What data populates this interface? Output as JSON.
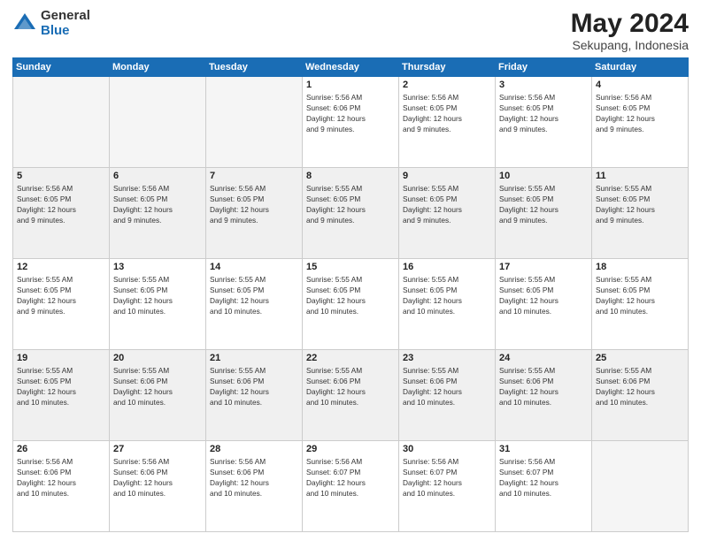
{
  "header": {
    "logo_general": "General",
    "logo_blue": "Blue",
    "month_title": "May 2024",
    "subtitle": "Sekupang, Indonesia"
  },
  "weekdays": [
    "Sunday",
    "Monday",
    "Tuesday",
    "Wednesday",
    "Thursday",
    "Friday",
    "Saturday"
  ],
  "weeks": [
    [
      {
        "day": "",
        "info": ""
      },
      {
        "day": "",
        "info": ""
      },
      {
        "day": "",
        "info": ""
      },
      {
        "day": "1",
        "info": "Sunrise: 5:56 AM\nSunset: 6:06 PM\nDaylight: 12 hours\nand 9 minutes."
      },
      {
        "day": "2",
        "info": "Sunrise: 5:56 AM\nSunset: 6:05 PM\nDaylight: 12 hours\nand 9 minutes."
      },
      {
        "day": "3",
        "info": "Sunrise: 5:56 AM\nSunset: 6:05 PM\nDaylight: 12 hours\nand 9 minutes."
      },
      {
        "day": "4",
        "info": "Sunrise: 5:56 AM\nSunset: 6:05 PM\nDaylight: 12 hours\nand 9 minutes."
      }
    ],
    [
      {
        "day": "5",
        "info": "Sunrise: 5:56 AM\nSunset: 6:05 PM\nDaylight: 12 hours\nand 9 minutes."
      },
      {
        "day": "6",
        "info": "Sunrise: 5:56 AM\nSunset: 6:05 PM\nDaylight: 12 hours\nand 9 minutes."
      },
      {
        "day": "7",
        "info": "Sunrise: 5:56 AM\nSunset: 6:05 PM\nDaylight: 12 hours\nand 9 minutes."
      },
      {
        "day": "8",
        "info": "Sunrise: 5:55 AM\nSunset: 6:05 PM\nDaylight: 12 hours\nand 9 minutes."
      },
      {
        "day": "9",
        "info": "Sunrise: 5:55 AM\nSunset: 6:05 PM\nDaylight: 12 hours\nand 9 minutes."
      },
      {
        "day": "10",
        "info": "Sunrise: 5:55 AM\nSunset: 6:05 PM\nDaylight: 12 hours\nand 9 minutes."
      },
      {
        "day": "11",
        "info": "Sunrise: 5:55 AM\nSunset: 6:05 PM\nDaylight: 12 hours\nand 9 minutes."
      }
    ],
    [
      {
        "day": "12",
        "info": "Sunrise: 5:55 AM\nSunset: 6:05 PM\nDaylight: 12 hours\nand 9 minutes."
      },
      {
        "day": "13",
        "info": "Sunrise: 5:55 AM\nSunset: 6:05 PM\nDaylight: 12 hours\nand 10 minutes."
      },
      {
        "day": "14",
        "info": "Sunrise: 5:55 AM\nSunset: 6:05 PM\nDaylight: 12 hours\nand 10 minutes."
      },
      {
        "day": "15",
        "info": "Sunrise: 5:55 AM\nSunset: 6:05 PM\nDaylight: 12 hours\nand 10 minutes."
      },
      {
        "day": "16",
        "info": "Sunrise: 5:55 AM\nSunset: 6:05 PM\nDaylight: 12 hours\nand 10 minutes."
      },
      {
        "day": "17",
        "info": "Sunrise: 5:55 AM\nSunset: 6:05 PM\nDaylight: 12 hours\nand 10 minutes."
      },
      {
        "day": "18",
        "info": "Sunrise: 5:55 AM\nSunset: 6:05 PM\nDaylight: 12 hours\nand 10 minutes."
      }
    ],
    [
      {
        "day": "19",
        "info": "Sunrise: 5:55 AM\nSunset: 6:05 PM\nDaylight: 12 hours\nand 10 minutes."
      },
      {
        "day": "20",
        "info": "Sunrise: 5:55 AM\nSunset: 6:06 PM\nDaylight: 12 hours\nand 10 minutes."
      },
      {
        "day": "21",
        "info": "Sunrise: 5:55 AM\nSunset: 6:06 PM\nDaylight: 12 hours\nand 10 minutes."
      },
      {
        "day": "22",
        "info": "Sunrise: 5:55 AM\nSunset: 6:06 PM\nDaylight: 12 hours\nand 10 minutes."
      },
      {
        "day": "23",
        "info": "Sunrise: 5:55 AM\nSunset: 6:06 PM\nDaylight: 12 hours\nand 10 minutes."
      },
      {
        "day": "24",
        "info": "Sunrise: 5:55 AM\nSunset: 6:06 PM\nDaylight: 12 hours\nand 10 minutes."
      },
      {
        "day": "25",
        "info": "Sunrise: 5:55 AM\nSunset: 6:06 PM\nDaylight: 12 hours\nand 10 minutes."
      }
    ],
    [
      {
        "day": "26",
        "info": "Sunrise: 5:56 AM\nSunset: 6:06 PM\nDaylight: 12 hours\nand 10 minutes."
      },
      {
        "day": "27",
        "info": "Sunrise: 5:56 AM\nSunset: 6:06 PM\nDaylight: 12 hours\nand 10 minutes."
      },
      {
        "day": "28",
        "info": "Sunrise: 5:56 AM\nSunset: 6:06 PM\nDaylight: 12 hours\nand 10 minutes."
      },
      {
        "day": "29",
        "info": "Sunrise: 5:56 AM\nSunset: 6:07 PM\nDaylight: 12 hours\nand 10 minutes."
      },
      {
        "day": "30",
        "info": "Sunrise: 5:56 AM\nSunset: 6:07 PM\nDaylight: 12 hours\nand 10 minutes."
      },
      {
        "day": "31",
        "info": "Sunrise: 5:56 AM\nSunset: 6:07 PM\nDaylight: 12 hours\nand 10 minutes."
      },
      {
        "day": "",
        "info": ""
      }
    ]
  ]
}
